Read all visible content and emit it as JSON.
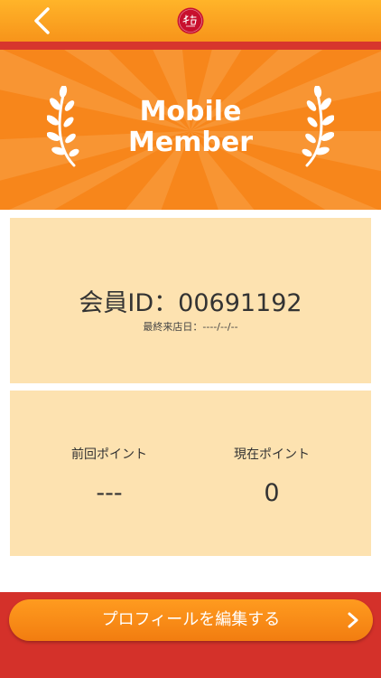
{
  "header": {
    "back_icon": "chevron-left-icon",
    "logo_text": "和吉"
  },
  "banner": {
    "title_line1": "Mobile",
    "title_line2": "Member",
    "left_icon": "laurel-left-icon",
    "right_icon": "laurel-right-icon"
  },
  "member_card": {
    "member_id": "会員ID：00691192",
    "last_visit": "最終来店日：----/--/--"
  },
  "points_card": {
    "previous_label": "前回ポイント",
    "previous_value": "---",
    "current_label": "現在ポイント",
    "current_value": "0"
  },
  "footer": {
    "edit_profile_label": "プロフィールを編集する",
    "arrow_icon": "chevron-right-icon"
  },
  "colors": {
    "accent_orange": "#f7861b",
    "header_orange": "#ffb429",
    "brand_red": "#d4312a",
    "card_background": "#fde2b0"
  }
}
